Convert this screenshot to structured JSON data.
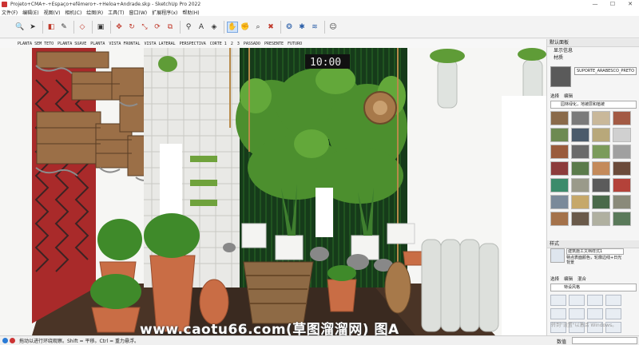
{
  "window": {
    "title": "Projeto+CMA+-+Espaço+efêmero+-+Heloa+Andrade.skp - SketchUp Pro 2022",
    "controls": [
      "—",
      "☐",
      "✕"
    ]
  },
  "menubar": {
    "items": [
      "文件(F)",
      "编辑(E)",
      "视图(V)",
      "相机(C)",
      "绘图(R)",
      "工具(T)",
      "窗口(W)",
      "扩展程序(x)",
      "帮助(H)"
    ]
  },
  "toolbar": {
    "tools": [
      {
        "name": "search-icon",
        "glyph": "🔍",
        "style": "dark"
      },
      {
        "name": "select-arrow-icon",
        "glyph": "➤",
        "style": "dark"
      },
      {
        "name": "sep"
      },
      {
        "name": "eraser-icon",
        "glyph": "◧",
        "style": "red"
      },
      {
        "name": "pencil-icon",
        "glyph": "✎",
        "style": "dark"
      },
      {
        "name": "sep"
      },
      {
        "name": "shape-icon",
        "glyph": "◇",
        "style": "red"
      },
      {
        "name": "sep"
      },
      {
        "name": "push-pull-icon",
        "glyph": "▣",
        "style": "dark"
      },
      {
        "name": "sep"
      },
      {
        "name": "move-icon",
        "glyph": "✥",
        "style": "red"
      },
      {
        "name": "rotate-icon",
        "glyph": "↻",
        "style": "red"
      },
      {
        "name": "scale-icon",
        "glyph": "⤡",
        "style": "red"
      },
      {
        "name": "follow-me-icon",
        "glyph": "⟳",
        "style": "red"
      },
      {
        "name": "offset-icon",
        "glyph": "⧉",
        "style": "red"
      },
      {
        "name": "sep"
      },
      {
        "name": "tape-measure-icon",
        "glyph": "⚲",
        "style": "dark"
      },
      {
        "name": "text-icon",
        "glyph": "A",
        "style": "dark"
      },
      {
        "name": "paint-bucket-icon",
        "glyph": "◈",
        "style": "dark"
      },
      {
        "name": "sep"
      },
      {
        "name": "orbit-icon",
        "glyph": "✋",
        "style": "active"
      },
      {
        "name": "pan-icon",
        "glyph": "✊",
        "style": "dark"
      },
      {
        "name": "zoom-icon",
        "glyph": "⌕",
        "style": "dark"
      },
      {
        "name": "zoom-extents-icon",
        "glyph": "✖",
        "style": "red"
      },
      {
        "name": "sep"
      },
      {
        "name": "3d-warehouse-icon",
        "glyph": "❂",
        "style": "normal"
      },
      {
        "name": "extension-warehouse-icon",
        "glyph": "✱",
        "style": "normal"
      },
      {
        "name": "layout-icon",
        "glyph": "≋",
        "style": "normal"
      },
      {
        "name": "sep"
      },
      {
        "name": "user-account-icon",
        "glyph": "☺",
        "style": "dark"
      }
    ]
  },
  "scenes": {
    "tabs": [
      "PLANTA SEM TETO",
      "PLANTA SUAVE",
      "PLANTA",
      "VISTA FRONTAL",
      "VISTA LATERAL",
      "PERSPECTIVA",
      "CORTE 1",
      "2",
      "3",
      "PASSADO",
      "PRESENTE",
      "FUTURO"
    ]
  },
  "viewport": {
    "clock_text": "10:00"
  },
  "tray": {
    "default_tray": "默认面板",
    "display_info": "显示信息",
    "materials_section": "材质",
    "material_name": "SUPORTE_ARABESCO_PRETO",
    "material_tabs": [
      "选择",
      "编辑"
    ],
    "material_library": "园林绿化，地被层和植被",
    "material_swatches": [
      "#8a6a4a",
      "#7a7a7a",
      "#c9b89a",
      "#a35a44",
      "#6d8a52",
      "#4b5b6b",
      "#b8a87a",
      "#d0d0d0",
      "#9a5b3c",
      "#6a6a6a",
      "#7b9b5b",
      "#a0a0a0",
      "#8c3b3b",
      "#5b7b4b",
      "#c48a5a",
      "#6b4b3b",
      "#3b8b6b",
      "#9a9a8a",
      "#5b5b5b",
      "#b4423a",
      "#7a8a9a",
      "#c6a86a",
      "#4a6a4a",
      "#8a8a7a",
      "#a4724a",
      "#6a5a4a",
      "#b0b0a0",
      "#5a7a5a"
    ],
    "styles_section": "样式",
    "style_name": "建筑施工文档样式1",
    "style_desc": "特点表面颜色，轮廓边线+日光背景",
    "style_tabs": [
      "选择",
      "编辑",
      "混合"
    ],
    "style_library": "特设风格"
  },
  "statusbar": {
    "message": "拖动以进行环绕观察。Shift = 平移。Ctrl = 重力悬浮。",
    "measure_label": "数值",
    "measure_value": ""
  },
  "overlay": {
    "watermark": "www.caotu66.com(草图溜溜网) 图A",
    "activate_windows": "转到\"设置\"以激活 Windows。"
  }
}
